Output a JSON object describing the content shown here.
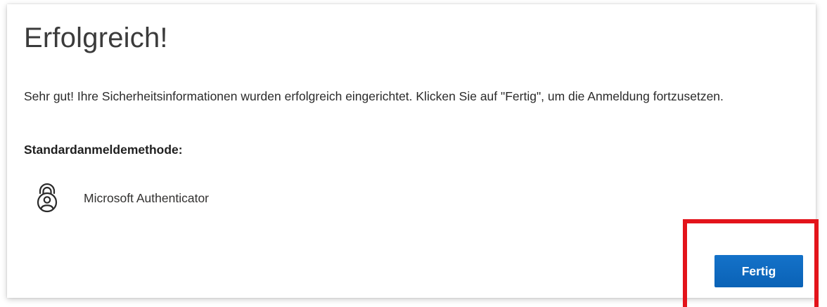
{
  "dialog": {
    "title": "Erfolgreich!",
    "message": "Sehr gut! Ihre Sicherheitsinformationen wurden erfolgreich eingerichtet. Klicken Sie auf \"Fertig\", um die Anmeldung fortzusetzen.",
    "default_method_heading": "Standardanmeldemethode:",
    "default_method": {
      "icon": "authenticator-lock-icon",
      "label": "Microsoft Authenticator"
    },
    "done_button_label": "Fertig"
  },
  "colors": {
    "button_blue": "#0f6cbd",
    "highlight_red": "#e3141b",
    "title_text": "#3b3b3b"
  }
}
